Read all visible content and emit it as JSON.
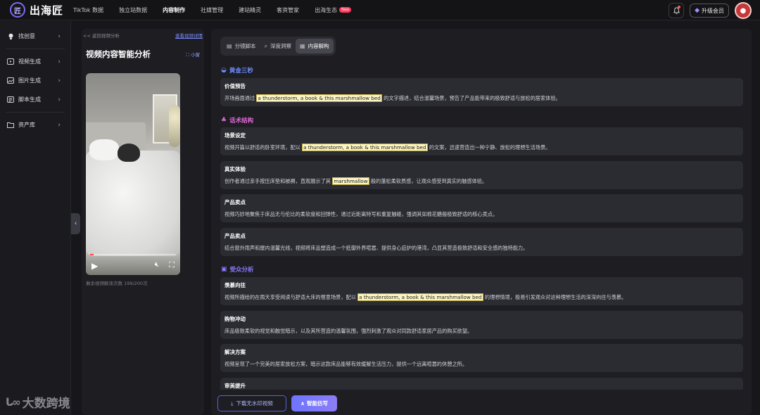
{
  "brand": {
    "logo_glyph": "匠",
    "name": "出海匠"
  },
  "nav": [
    {
      "label": "TikTok 数据",
      "active": false
    },
    {
      "label": "独立站数据",
      "active": false
    },
    {
      "label": "内容制作",
      "active": true
    },
    {
      "label": "社媒管理",
      "active": false
    },
    {
      "label": "建站精灵",
      "active": false
    },
    {
      "label": "客资管家",
      "active": false
    },
    {
      "label": "出海生态",
      "active": false,
      "badge": "New"
    }
  ],
  "header": {
    "upgrade_label": "升级会员",
    "bell_icon": "bell-icon",
    "avatar_icon": "avatar-icon"
  },
  "sidebar": {
    "items": [
      {
        "label": "找创意",
        "icon": "lightbulb-icon"
      },
      {
        "label": "视频生成",
        "icon": "video-icon"
      },
      {
        "label": "图片生成",
        "icon": "image-icon"
      },
      {
        "label": "脚本生成",
        "icon": "script-icon"
      },
      {
        "label": "资产库",
        "icon": "folder-icon"
      }
    ],
    "watermark": "大数跨境"
  },
  "left_panel": {
    "back_link": "<< 返回视频分析",
    "detail_link": "查看视频详情",
    "title": "视频内容智能分析",
    "small_toggle": "小窗",
    "remaining": "剩余视频解读次数 199/200次",
    "video": {
      "progress": 0.04
    }
  },
  "tabs": [
    {
      "label": "分镜脚本",
      "icon": "doc-icon",
      "active": false
    },
    {
      "label": "深度洞察",
      "icon": "search-icon",
      "active": false
    },
    {
      "label": "内容解构",
      "icon": "list-icon",
      "active": true
    }
  ],
  "sections": {
    "golden": {
      "title": "黄金三秒",
      "color": "#6d8cff"
    },
    "script": {
      "title": "话术结构",
      "color": "#e06ad8"
    },
    "audience": {
      "title": "受众分析",
      "color": "#8a7cff"
    }
  },
  "cards": [
    {
      "title": "价值预告",
      "pre": "开场画面通过 ",
      "hl": "a thunderstorm, a book & this marshmallow bed",
      "post": " 的文字描述，结合温馨场景，预告了产品能带来的极致舒适与放松的居家体验。"
    },
    {
      "title": "场景设定",
      "pre": "视频开篇以舒适的卧室环境，配以 ",
      "hl": "a thunderstorm, a book & this marshmallow bed",
      "post": " 的文案，迅速营造出一种宁静、放松的理想生活场景。"
    },
    {
      "title": "真实体验",
      "pre": "创作者通过亲手按压床垫和被褥，直观展示了其 ",
      "hl": "marshmallow",
      "post": " 般的蓬松柔软质感，让观众感受到真实的触感体验。"
    },
    {
      "title": "产品卖点",
      "pre": "视频巧妙地聚焦于床品无与伦比的柔软度和回弹性，通过近距离特写和重复触碰，强调其如棉花糖般极致舒适的核心卖点。",
      "hl": "",
      "post": ""
    },
    {
      "title": "产品卖点",
      "pre": "结合窗外雨声和屋内温馨光线，视频将床品塑造成一个抵御外界喧嚣、提供身心庇护的港湾，凸显其营造极致舒适和安全感的独特能力。",
      "hl": "",
      "post": ""
    },
    {
      "title": "羡慕向往",
      "pre": "视频所描绘的在雨天享受阅读与舒适大床的惬意场景，配以 ",
      "hl": "a thunderstorm, a book & this marshmallow bed",
      "post": " 的理想情境，极易引发观众对这种理想生活的深深向往与羡慕。"
    },
    {
      "title": "购物冲动",
      "pre": "床品极致柔软的视觉和触觉暗示，以及其所营造的温馨氛围，强烈刺激了观众对同款舒适家居产品的购买欲望。",
      "hl": "",
      "post": ""
    },
    {
      "title": "解决方案",
      "pre": "视频呈现了一个完美的居家放松方案，暗示这款床品能够有效缓解生活压力，提供一个远离喧嚣的休憩之所。",
      "hl": "",
      "post": ""
    },
    {
      "title": "审美提升",
      "pre": "",
      "hl": "",
      "post": ""
    }
  ],
  "actions": {
    "download": "下载无水印视频",
    "smart": "智能仿写"
  }
}
